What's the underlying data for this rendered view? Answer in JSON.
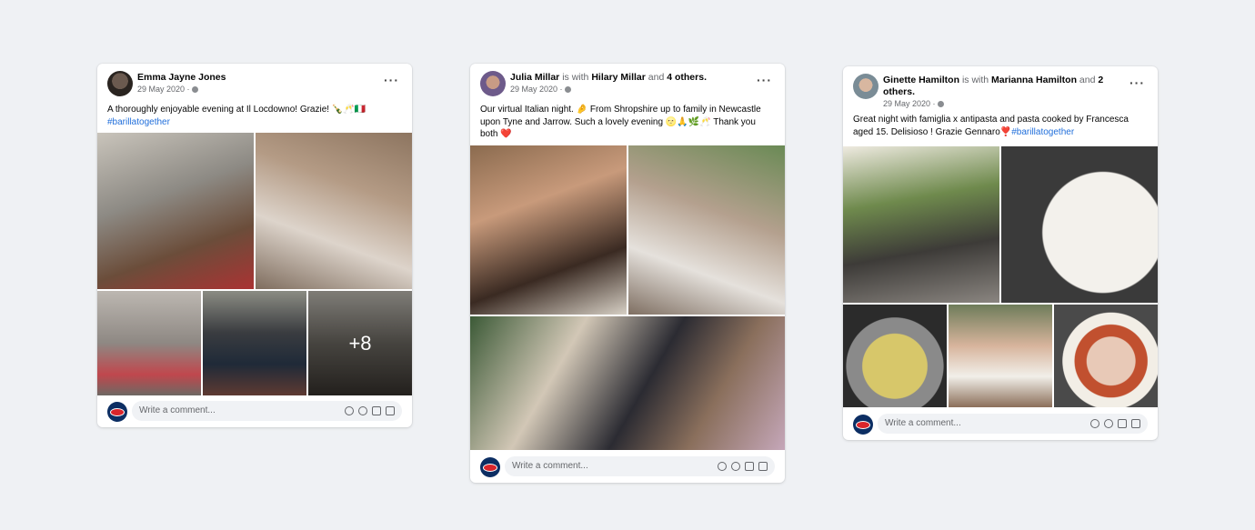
{
  "posts": [
    {
      "author": "Emma Jayne Jones",
      "with_text": "",
      "with_name": "",
      "and_text": "",
      "others": "",
      "date": "29 May 2020 ·",
      "caption": "A thoroughly enjoyable evening at Il Locdowno! Grazie! 🍾🥂🇮🇹",
      "hashtag": "#barillatogether",
      "more_count": "+8",
      "comment_placeholder": "Write a comment..."
    },
    {
      "author": "Julia Millar",
      "with_text": "is with",
      "with_name": "Hilary Millar",
      "and_text": "and",
      "others": "4 others.",
      "date": "29 May 2020 ·",
      "caption": "Our virtual Italian night. 🤌 From Shropshire up to family in Newcastle upon Tyne and Jarrow. Such a lovely evening 🌝🙏🌿🥂 Thank you both ❤️",
      "hashtag": "",
      "comment_placeholder": "Write a comment..."
    },
    {
      "author": "Ginette Hamilton",
      "with_text": "is with",
      "with_name": "Marianna Hamilton",
      "and_text": "and",
      "others": "2 others.",
      "date": "29 May 2020 ·",
      "caption": "Great night with famiglia x antipasta and pasta cooked by Francesca aged 15. Delisioso ! Grazie Gennaro❣️",
      "hashtag": "#barillatogether",
      "comment_placeholder": "Write a comment..."
    }
  ],
  "more_icon": "more-horizontal-icon",
  "globe_icon": "globe-icon",
  "comment_icons": [
    "emoji-icon",
    "camera-icon",
    "gif-icon",
    "sticker-icon"
  ],
  "colors": {
    "background": "#eff1f4",
    "link": "#216fdb",
    "brand_avatar": "#0c2e63"
  }
}
